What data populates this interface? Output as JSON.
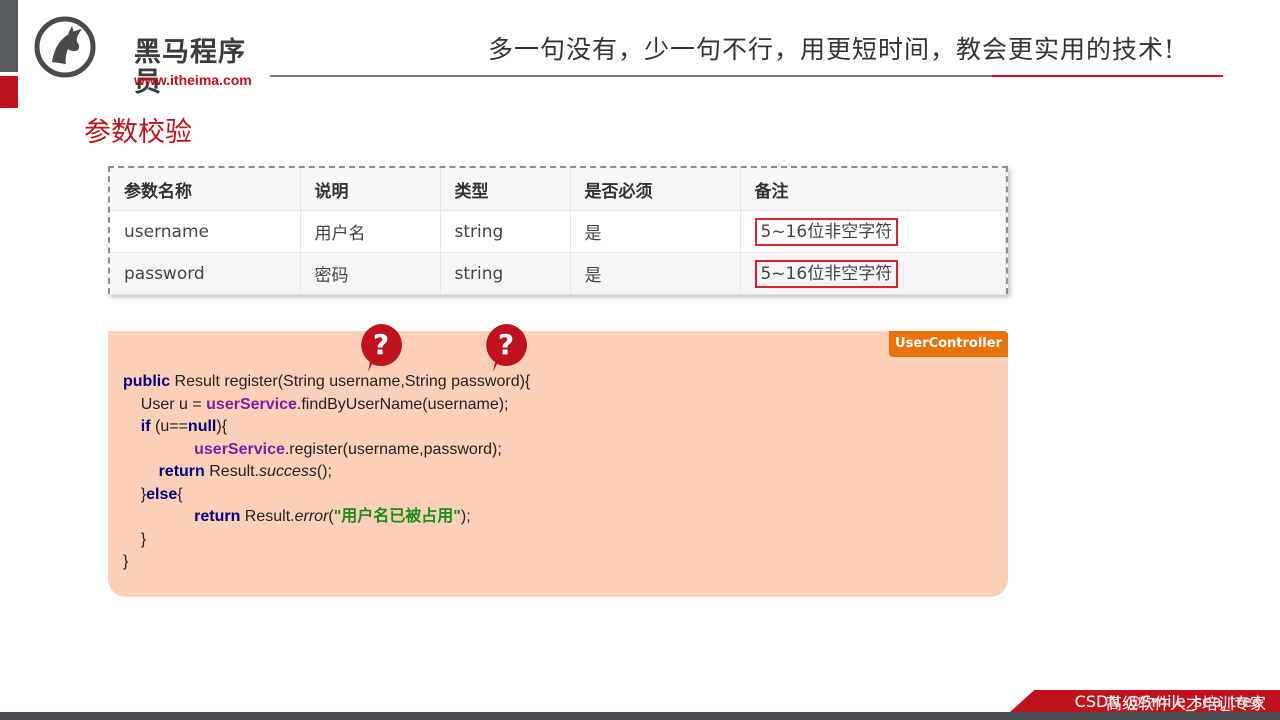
{
  "brand": {
    "name_cn": "黑马程序员",
    "url": "www.itheima.com"
  },
  "slogan": "多一句没有，少一句不行，用更短时间，教会更实用的技术!",
  "section_title": "参数校验",
  "table": {
    "headers": [
      "参数名称",
      "说明",
      "类型",
      "是否必须",
      "备注"
    ],
    "rows": [
      [
        "username",
        "用户名",
        "string",
        "是",
        "5~16位非空字符"
      ],
      [
        "password",
        "密码",
        "string",
        "是",
        "5~16位非空字符"
      ]
    ]
  },
  "code_panel": {
    "tag": "UserController",
    "lines": {
      "l1_kw": "public",
      "l1_rest": " Result register(String username,String password){",
      "l2_a": "    User u = ",
      "l2_svc": "userService",
      "l2_b": ".findByUserName(username);",
      "l3_kw1": "if",
      "l3_a": " (u==",
      "l3_kw2": "null",
      "l3_b": "){",
      "l4_svc": "userService",
      "l4_b": ".register(username,password);",
      "l5_kw": "return",
      "l5_a": " Result.",
      "l5_it": "success",
      "l5_b": "();",
      "l6_a": "}",
      "l6_kw": "else",
      "l6_b": "{",
      "l7_kw": "return",
      "l7_a": " Result.",
      "l7_it": "error",
      "l7_b": "(",
      "l7_str": "\"用户名已被占用\"",
      "l7_c": ");",
      "l8": "}",
      "l9": "}"
    }
  },
  "markers": {
    "symbol": "?"
  },
  "footer": {
    "text": "高级软件人才培训专家",
    "watermark": "CSDN @Smile_sea_tree"
  },
  "colors": {
    "brand_red": "#c0121c",
    "panel_bg": "#fcd0b8",
    "tag_orange": "#e8730c",
    "highlight_border": "#e0202a"
  },
  "icons": {
    "logo": "horse-head-logo-icon",
    "marker": "question-bubble-icon"
  }
}
